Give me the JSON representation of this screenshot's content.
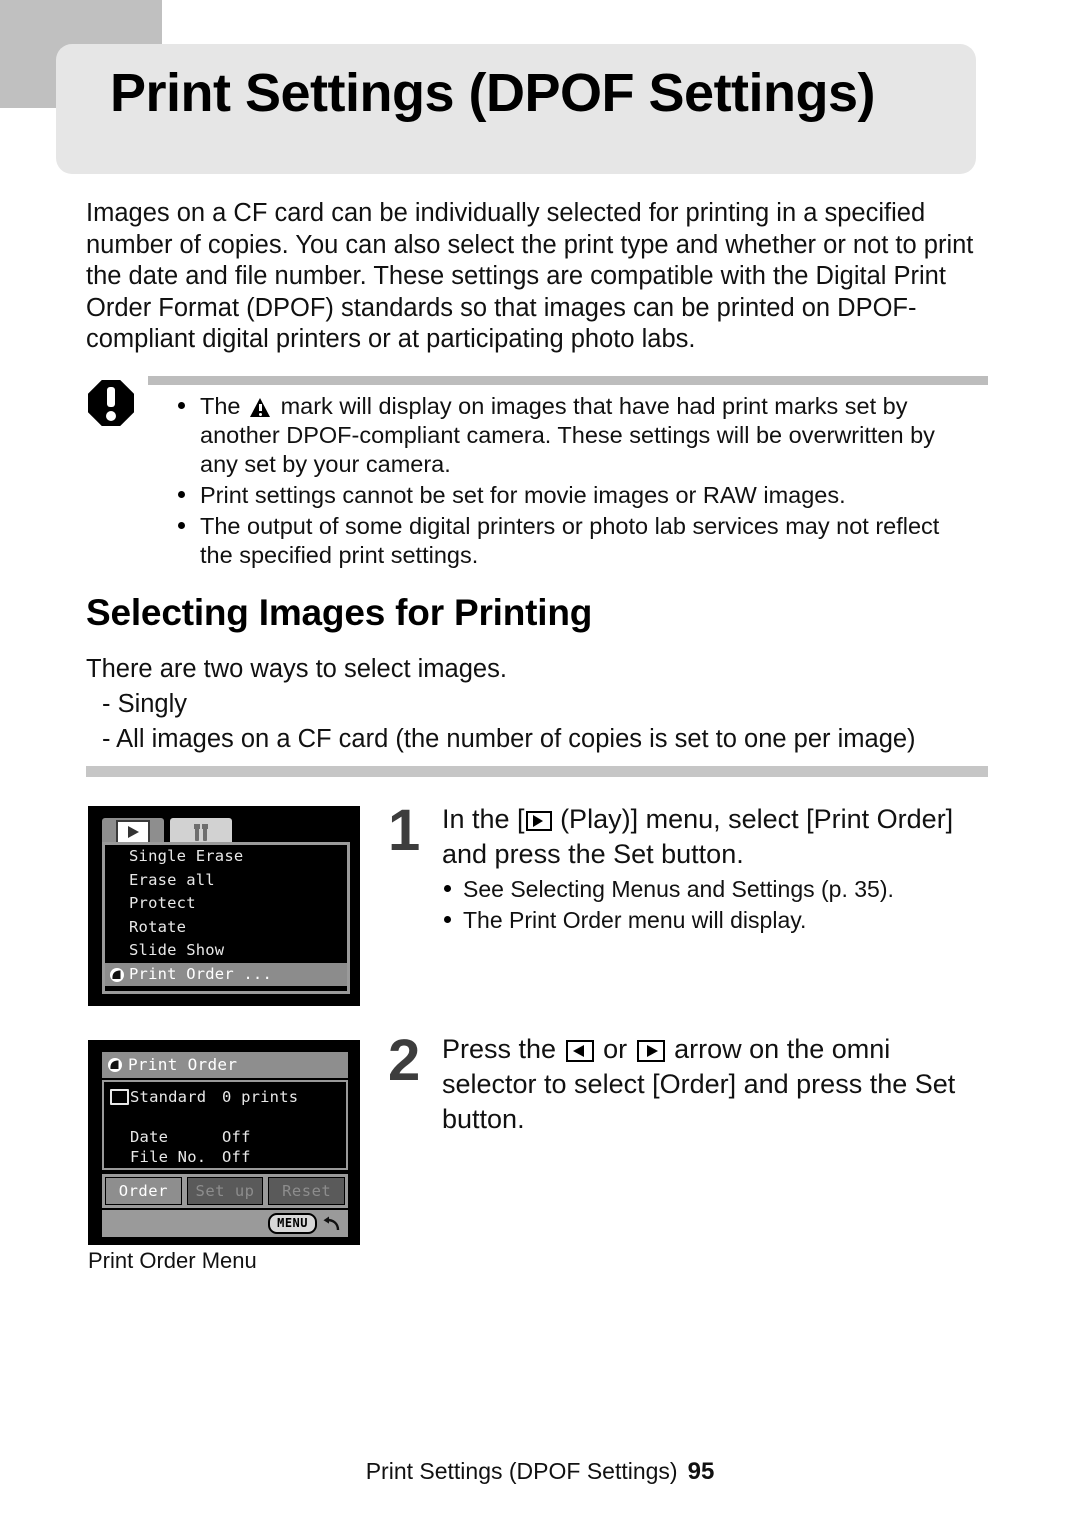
{
  "page": {
    "title": "Print Settings (DPOF Settings)",
    "footer_title": "Print Settings (DPOF Settings)",
    "page_number": "95"
  },
  "intro": {
    "paragraph": "Images on a CF card can be individually selected for printing in a specified number of copies. You can also select the print type and whether or not to print the date and file number. These settings are compatible with the Digital Print Order Format (DPOF) standards so that images can be printed on DPOF-compliant digital printers or at participating photo labs."
  },
  "note": {
    "icon": "caution-octagon-icon",
    "items": [
      {
        "prefix": "The",
        "inline_icon": "warning-triangle-icon",
        "suffix": "mark will display on images that have had print marks set by another DPOF-compliant camera. These settings will be overwritten by any set by your camera."
      },
      {
        "text": "Print settings cannot be set for movie images or RAW images."
      },
      {
        "text": "The output of some digital printers or photo lab services may not reflect the specified print settings."
      }
    ]
  },
  "section": {
    "heading": "Selecting Images for Printing",
    "intro_line": "There are two ways to select images.",
    "options": [
      "- Singly",
      "- All images on a CF card (the number of copies is set to one per image)"
    ]
  },
  "lcd_play_menu": {
    "tabs": [
      {
        "name": "play-tab",
        "icon": "play-icon",
        "selected": true
      },
      {
        "name": "tools-tab",
        "icon": "wrench-icon",
        "selected": false
      }
    ],
    "items": [
      {
        "label": "Single Erase",
        "highlighted": false
      },
      {
        "label": "Erase all",
        "highlighted": false
      },
      {
        "label": "Protect",
        "highlighted": false
      },
      {
        "label": "Rotate",
        "highlighted": false
      },
      {
        "label": "Slide Show",
        "highlighted": false
      },
      {
        "label": "Print Order ...",
        "highlighted": true,
        "icon": "print-order-icon"
      }
    ]
  },
  "lcd_print_order": {
    "title": "Print Order",
    "title_icon": "print-order-icon",
    "rows": [
      {
        "icon": "standard-icon",
        "label": "Standard",
        "value": "0 prints"
      },
      {
        "label": "Date",
        "value": "Off"
      },
      {
        "label": "File No.",
        "value": "Off"
      }
    ],
    "buttons": [
      {
        "label": "Order",
        "state": "active"
      },
      {
        "label": "Set up",
        "state": "dimmed"
      },
      {
        "label": "Reset",
        "state": "dimmed"
      }
    ],
    "footer": {
      "menu_label": "MENU",
      "back_icon": "back-arrow-icon"
    },
    "caption": "Print Order Menu"
  },
  "steps": [
    {
      "number": "1",
      "text_before_icon": "In the [",
      "icon": "play-icon",
      "text_after_icon": " (Play)] menu, select [Print Order] and press the Set button.",
      "bullets": [
        "See Selecting Menus and Settings (p. 35).",
        "The Print Order menu will display."
      ]
    },
    {
      "number": "2",
      "text_before_icons": "Press the",
      "icon_left": "arrow-left-icon",
      "text_between_icons": "or",
      "icon_right": "arrow-right-icon",
      "text_after_icons": "arrow on the omni selector to select [Order] and press the Set button.",
      "bullets": []
    }
  ],
  "colors": {
    "corner_block": "#c0c0c0",
    "title_plate": "#e6e6e6",
    "rule_gray": "#c6c6c6",
    "step_number": "#3d3d3d"
  }
}
